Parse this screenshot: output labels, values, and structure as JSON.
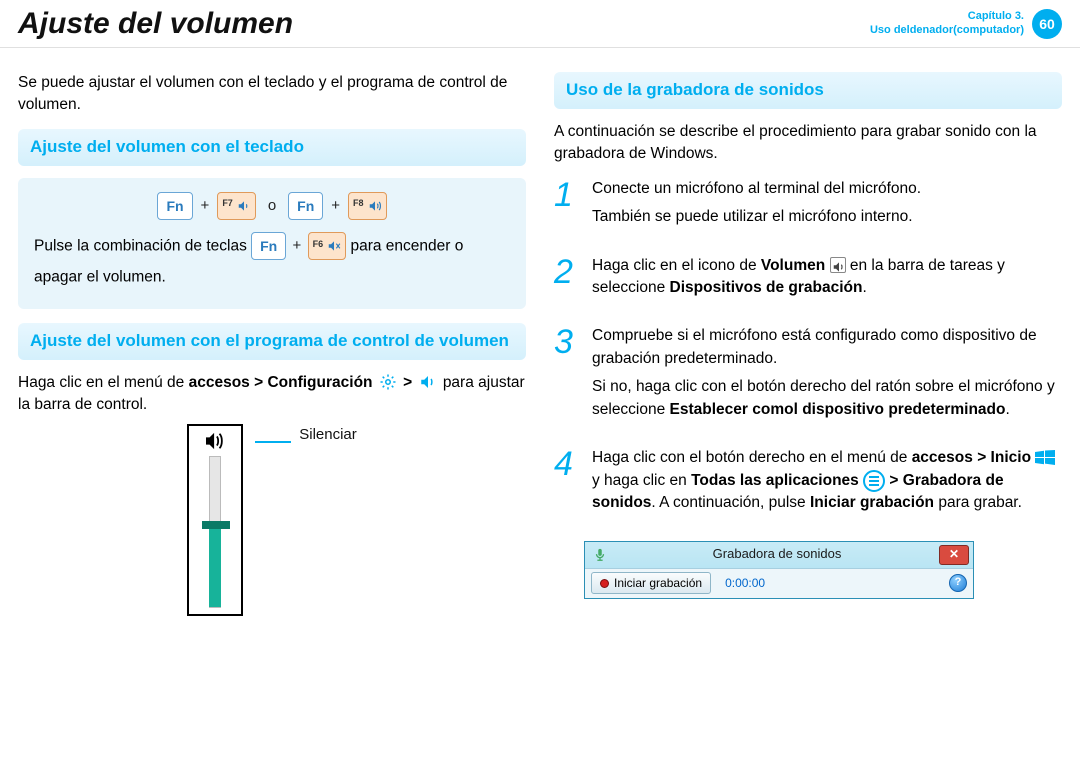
{
  "header": {
    "title": "Ajuste del volumen",
    "chapter_line1": "Capítulo 3.",
    "chapter_line2": "Uso deldenador(computador)",
    "page_number": "60"
  },
  "left": {
    "intro": "Se puede ajustar el volumen con el teclado y el programa de control de volumen.",
    "section1_title": "Ajuste del volumen con el teclado",
    "keys": {
      "fn": "Fn",
      "f7": "F7",
      "f8": "F8",
      "f6": "F6",
      "plus": "+",
      "or": "o"
    },
    "kb_line2_a": "Pulse la combinación de teclas ",
    "kb_line2_b": " para encender o apagar el volumen.",
    "section2_title": "Ajuste del volumen con el programa de control de volumen",
    "vol_para_a": "Haga clic en el menú de ",
    "vol_para_b": "accesos > Configuración",
    "vol_para_c": " > ",
    "vol_para_d": " para ajustar la barra de control.",
    "mute_label": "Silenciar"
  },
  "right": {
    "section_title": "Uso de la grabadora de sonidos",
    "intro": "A continuación se describe el procedimiento para grabar sonido con la grabadora de Windows.",
    "steps": {
      "s1": {
        "num": "1",
        "a": "Conecte un micrófono al terminal del micrófono.",
        "b": "También se puede utilizar el micrófono interno."
      },
      "s2": {
        "num": "2",
        "a": "Haga clic en el icono de ",
        "b": "Volumen",
        "c": " en la barra de tareas y seleccione ",
        "d": "Dispositivos de grabación",
        "e": "."
      },
      "s3": {
        "num": "3",
        "a": "Compruebe si el micrófono está configurado como dispositivo de grabación predeterminado.",
        "b": "Si no, haga clic con el botón derecho del ratón sobre el micrófono y seleccione ",
        "c": "Establecer comol dispositivo predeterminado",
        "d": "."
      },
      "s4": {
        "num": "4",
        "a": "Haga clic con el botón derecho en el menú de ",
        "b": "accesos",
        "c": " > Inicio ",
        "d": " y haga clic en ",
        "e": "Todas las aplicaciones",
        "f": " > Grabadora de sonidos",
        "g": ". A continuación, pulse ",
        "h": "Iniciar grabación",
        "i": " para grabar."
      }
    },
    "recorder": {
      "title": "Grabadora de sonidos",
      "button": "Iniciar grabación",
      "time": "0:00:00",
      "close": "✕",
      "help": "?"
    }
  }
}
